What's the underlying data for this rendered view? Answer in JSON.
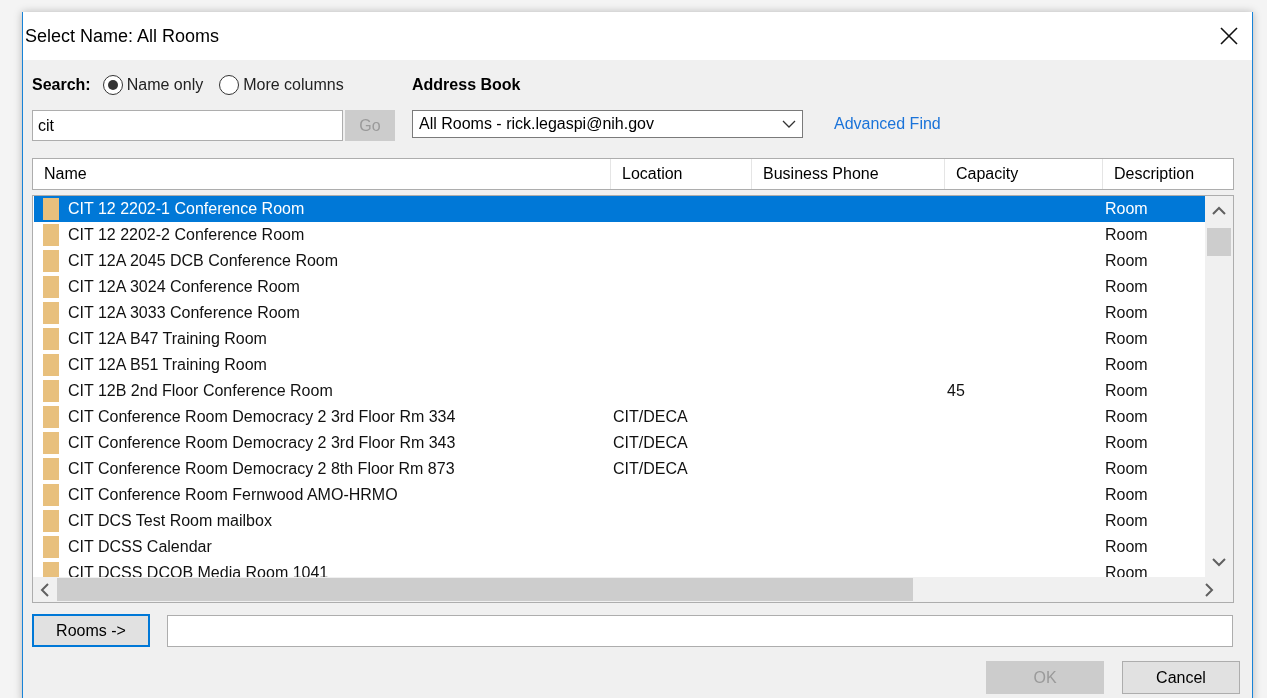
{
  "window": {
    "title": "Select Name: All Rooms"
  },
  "search": {
    "label": "Search:",
    "options": [
      {
        "label": "Name only",
        "selected": true
      },
      {
        "label": "More columns",
        "selected": false
      }
    ],
    "value": "cit",
    "go_button": {
      "label": "Go",
      "disabled": true
    }
  },
  "address_book": {
    "label": "Address Book",
    "value": "All Rooms - rick.legaspi@nih.gov",
    "advanced_find": "Advanced Find"
  },
  "table": {
    "columns": [
      "Name",
      "Location",
      "Business Phone",
      "Capacity",
      "Description"
    ],
    "rows": [
      {
        "name": "CIT 12 2202-1 Conference Room",
        "location": "",
        "phone": "",
        "capacity": "",
        "description": "Room",
        "selected": true
      },
      {
        "name": "CIT 12 2202-2 Conference Room",
        "location": "",
        "phone": "",
        "capacity": "",
        "description": "Room",
        "selected": false
      },
      {
        "name": "CIT 12A 2045 DCB Conference Room",
        "location": "",
        "phone": "",
        "capacity": "",
        "description": "Room",
        "selected": false
      },
      {
        "name": "CIT 12A 3024 Conference Room",
        "location": "",
        "phone": "",
        "capacity": "",
        "description": "Room",
        "selected": false
      },
      {
        "name": "CIT 12A 3033 Conference Room",
        "location": "",
        "phone": "",
        "capacity": "",
        "description": "Room",
        "selected": false
      },
      {
        "name": "CIT 12A B47 Training Room",
        "location": "",
        "phone": "",
        "capacity": "",
        "description": "Room",
        "selected": false
      },
      {
        "name": "CIT 12A B51 Training Room",
        "location": "",
        "phone": "",
        "capacity": "",
        "description": "Room",
        "selected": false
      },
      {
        "name": "CIT 12B 2nd Floor Conference Room",
        "location": "",
        "phone": "",
        "capacity": "45",
        "description": "Room",
        "selected": false
      },
      {
        "name": "CIT Conference Room Democracy 2 3rd Floor Rm 334",
        "location": "CIT/DECA",
        "phone": "",
        "capacity": "",
        "description": "Room",
        "selected": false
      },
      {
        "name": "CIT Conference Room Democracy 2 3rd Floor Rm 343",
        "location": "CIT/DECA",
        "phone": "",
        "capacity": "",
        "description": "Room",
        "selected": false
      },
      {
        "name": "CIT Conference Room Democracy 2 8th Floor Rm 873",
        "location": "CIT/DECA",
        "phone": "",
        "capacity": "",
        "description": "Room",
        "selected": false
      },
      {
        "name": "CIT Conference Room Fernwood AMO-HRMO",
        "location": "",
        "phone": "",
        "capacity": "",
        "description": "Room",
        "selected": false
      },
      {
        "name": "CIT DCS Test Room mailbox",
        "location": "",
        "phone": "",
        "capacity": "",
        "description": "Room",
        "selected": false
      },
      {
        "name": "CIT DCSS Calendar",
        "location": "",
        "phone": "",
        "capacity": "",
        "description": "Room",
        "selected": false
      },
      {
        "name": "CIT DCSS DCOB Media Room 1041",
        "location": "",
        "phone": "",
        "capacity": "",
        "description": "Room",
        "selected": false
      }
    ]
  },
  "rooms_button": {
    "label": "Rooms ->"
  },
  "buttons": [
    {
      "label": "OK",
      "disabled": true
    },
    {
      "label": "Cancel",
      "disabled": false
    }
  ]
}
